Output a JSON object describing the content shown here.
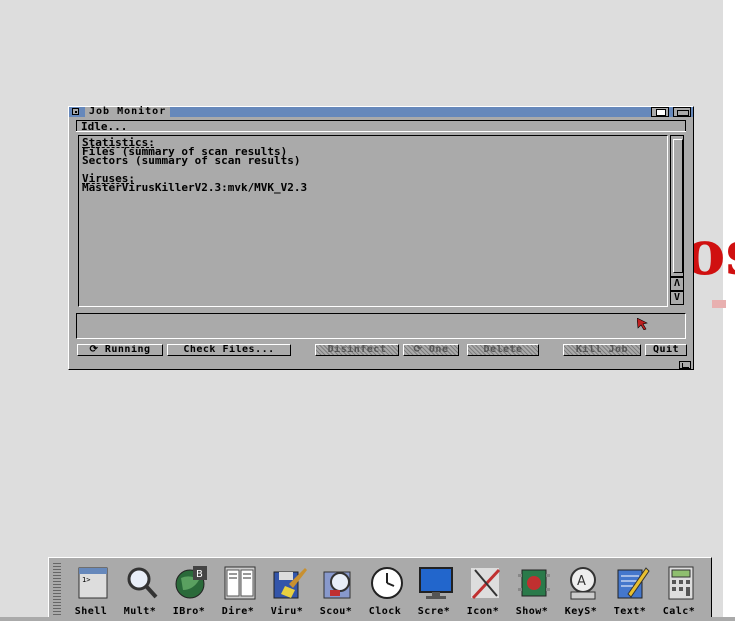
{
  "window": {
    "title": "Job Monitor",
    "status": "Idle...",
    "list_lines": [
      {
        "text": "Statistics:",
        "heading": true
      },
      {
        "text": "Files (summary of scan results)",
        "heading": false
      },
      {
        "text": "Sectors (summary of scan results)",
        "heading": false
      },
      {
        "text": "",
        "heading": false
      },
      {
        "text": "Viruses:",
        "heading": true
      },
      {
        "text": "MasterVirusKillerV2.3:mvk/MVK_V2.3",
        "heading": false
      }
    ],
    "scroll_up_label": "Λ",
    "scroll_down_label": "V",
    "buttons": {
      "running": "⟳ Running",
      "check_files": "Check Files...",
      "disinfect": "Disinfect",
      "clone": "⟳ One",
      "delete": "Delete",
      "kill_job": "Kill Job",
      "quit": "Quit"
    }
  },
  "dock": {
    "items": [
      {
        "label": "Shell",
        "icon": "shell-icon"
      },
      {
        "label": "Mult*",
        "icon": "magnifier-icon"
      },
      {
        "label": "IBro*",
        "icon": "globe-browser-icon"
      },
      {
        "label": "Dire*",
        "icon": "directory-opus-icon"
      },
      {
        "label": "Viru*",
        "icon": "floppy-broom-icon"
      },
      {
        "label": "Scou*",
        "icon": "scout-icon"
      },
      {
        "label": "Clock",
        "icon": "clock-icon"
      },
      {
        "label": "Scre*",
        "icon": "screen-monitor-icon"
      },
      {
        "label": "Icon*",
        "icon": "icon-editor-icon"
      },
      {
        "label": "Show*",
        "icon": "show-chip-icon"
      },
      {
        "label": "KeyS*",
        "icon": "keyboard-search-icon"
      },
      {
        "label": "Text*",
        "icon": "notepad-pencil-icon"
      },
      {
        "label": "Calc*",
        "icon": "calculator-icon"
      }
    ]
  }
}
